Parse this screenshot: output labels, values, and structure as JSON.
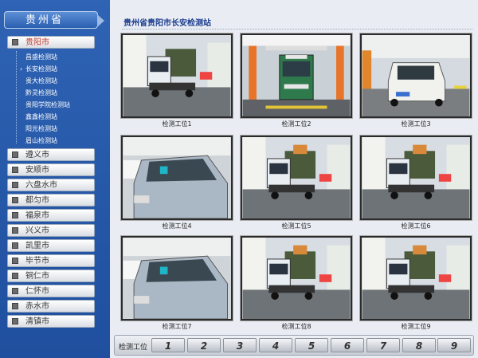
{
  "sidebar": {
    "province": "贵州省",
    "cities": [
      {
        "label": "贵阳市",
        "active": true
      },
      {
        "label": "遵义市"
      },
      {
        "label": "安顺市"
      },
      {
        "label": "六盘水市"
      },
      {
        "label": "都匀市"
      },
      {
        "label": "福泉市"
      },
      {
        "label": "兴义市"
      },
      {
        "label": "凯里市"
      },
      {
        "label": "毕节市"
      },
      {
        "label": "铜仁市"
      },
      {
        "label": "仁怀市"
      },
      {
        "label": "赤水市"
      },
      {
        "label": "清镇市"
      }
    ],
    "stations": [
      "昌盛检测站",
      "长安检测站",
      "贵大检测站",
      "黔灵检测站",
      "贵阳学院检测站",
      "鑫鑫检测站",
      "阳光检测站",
      "眉山检测站"
    ],
    "current_station": "长安检测站"
  },
  "main": {
    "title": "贵州省贵阳市长安检测站",
    "cameras": [
      {
        "caption": "检测工位1",
        "scene": "truck"
      },
      {
        "caption": "检测工位2",
        "scene": "bus"
      },
      {
        "caption": "检测工位3",
        "scene": "minicar"
      },
      {
        "caption": "检测工位4",
        "scene": "sedan"
      },
      {
        "caption": "检测工位5",
        "scene": "truck"
      },
      {
        "caption": "检测工位6",
        "scene": "truck"
      },
      {
        "caption": "检测工位7",
        "scene": "sedan"
      },
      {
        "caption": "检测工位8",
        "scene": "truck"
      },
      {
        "caption": "检测工位9",
        "scene": "truck"
      }
    ]
  },
  "bottom_bar": {
    "label": "检测工位",
    "buttons": [
      "1",
      "2",
      "3",
      "4",
      "5",
      "6",
      "7",
      "8",
      "9"
    ]
  },
  "colors": {
    "sidebar_bg": "#2a5aa8",
    "title": "#1b3d8f",
    "active_city": "#c0392b"
  }
}
